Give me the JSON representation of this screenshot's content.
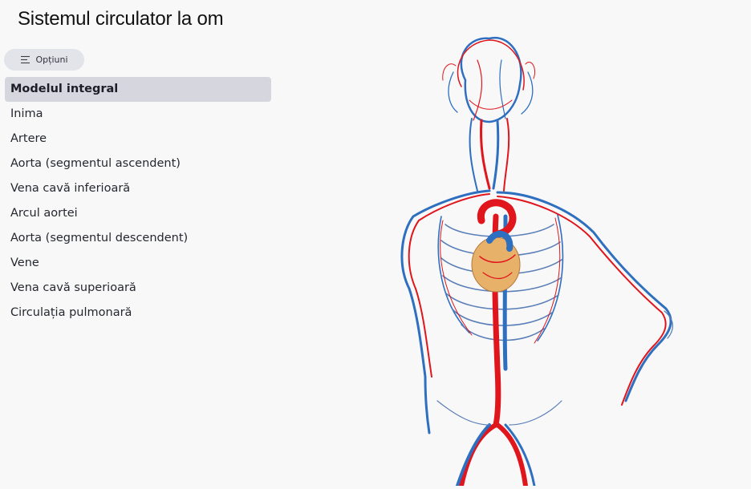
{
  "app": {
    "title": "Sistemul circulator la om"
  },
  "options": {
    "label": "Opțiuni",
    "icon": "menu-lines-icon"
  },
  "menu": {
    "active_index": 0,
    "items": [
      {
        "label": "Modelul integral"
      },
      {
        "label": "Inima"
      },
      {
        "label": "Artere"
      },
      {
        "label": "Aorta (segmentul ascendent)"
      },
      {
        "label": "Vena cavă inferioară"
      },
      {
        "label": "Arcul aortei"
      },
      {
        "label": "Aorta (segmentul descendent)"
      },
      {
        "label": "Vene"
      },
      {
        "label": "Vena cavă superioară"
      },
      {
        "label": "Circulația pulmonară"
      }
    ]
  },
  "colors": {
    "artery": "#e0161c",
    "vein": "#2f6fc0",
    "heart": "#e7b16a",
    "active_bg": "#d5d6de"
  }
}
